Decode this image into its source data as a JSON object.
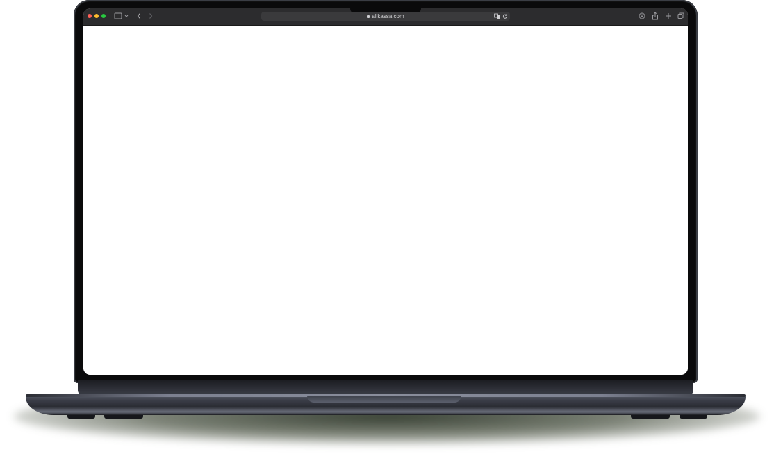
{
  "browser": {
    "address_text": "allkassa.com",
    "icons": {
      "sidebar": "sidebar-icon",
      "chevron": "chevron-down-icon",
      "back": "back-arrow-icon",
      "forward": "forward-arrow-icon",
      "lock": "lock-icon",
      "translate": "translate-icon",
      "reload": "reload-icon",
      "download": "download-icon",
      "share": "share-icon",
      "new_tab": "plus-icon",
      "tabs_overview": "tabs-overview-icon"
    },
    "colors": {
      "toolbar": "#2c2c2e",
      "close": "#ff5f57",
      "minimize": "#febc2e",
      "zoom": "#28c840"
    }
  }
}
